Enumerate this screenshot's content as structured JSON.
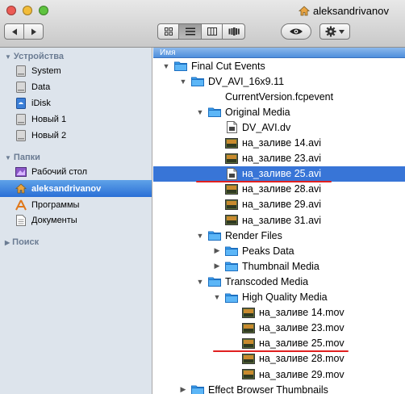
{
  "window": {
    "title": "aleksandrivanov",
    "title_icon": "home-icon"
  },
  "toolbar": {
    "back_icon": "back-arrow-icon",
    "forward_icon": "forward-arrow-icon",
    "views": [
      {
        "name": "icon-view",
        "icon": "grid-icon",
        "active": false
      },
      {
        "name": "list-view",
        "icon": "list-icon",
        "active": true
      },
      {
        "name": "column-view",
        "icon": "columns-icon",
        "active": false
      },
      {
        "name": "coverflow-view",
        "icon": "coverflow-icon",
        "active": false
      }
    ],
    "quicklook_icon": "eye-icon",
    "action_icon": "gear-icon"
  },
  "sidebar": {
    "devices": {
      "header": "Устройства",
      "items": [
        {
          "label": "System",
          "icon": "hard-drive-icon"
        },
        {
          "label": "Data",
          "icon": "hard-drive-icon"
        },
        {
          "label": "iDisk",
          "icon": "idisk-icon"
        },
        {
          "label": "Новый 1",
          "icon": "hard-drive-icon"
        },
        {
          "label": "Новый 2",
          "icon": "hard-drive-icon"
        }
      ]
    },
    "places": {
      "header": "Папки",
      "items": [
        {
          "label": "Рабочий стол",
          "icon": "desktop-icon"
        },
        {
          "label": "aleksandrivanov",
          "icon": "home-icon",
          "selected": true
        },
        {
          "label": "Программы",
          "icon": "applications-icon"
        },
        {
          "label": "Документы",
          "icon": "documents-icon"
        }
      ]
    },
    "search": {
      "header": "Поиск"
    }
  },
  "list": {
    "column_header": "Имя",
    "rows": [
      {
        "label": "Final Cut Events",
        "depth": 0,
        "disclosure": "open",
        "icon": "folder-icon"
      },
      {
        "label": "DV_AVI_16x9.11",
        "depth": 1,
        "disclosure": "open",
        "icon": "folder-icon"
      },
      {
        "label": "CurrentVersion.fcpevent",
        "depth": 2,
        "disclosure": "none",
        "icon": "none"
      },
      {
        "label": "Original Media",
        "depth": 2,
        "disclosure": "open",
        "icon": "folder-icon"
      },
      {
        "label": "DV_AVI.dv",
        "depth": 3,
        "disclosure": "none",
        "icon": "document-icon"
      },
      {
        "label": "на_заливе 14.avi",
        "depth": 3,
        "disclosure": "none",
        "icon": "video-thumb-icon"
      },
      {
        "label": "на_заливе 23.avi",
        "depth": 3,
        "disclosure": "none",
        "icon": "video-thumb-icon"
      },
      {
        "label": "на_заливе 25.avi",
        "depth": 3,
        "disclosure": "none",
        "icon": "document-icon",
        "selected": true,
        "underlined": true
      },
      {
        "label": "на_заливе 28.avi",
        "depth": 3,
        "disclosure": "none",
        "icon": "video-thumb-icon"
      },
      {
        "label": "на_заливе 29.avi",
        "depth": 3,
        "disclosure": "none",
        "icon": "video-thumb-icon"
      },
      {
        "label": "на_заливе 31.avi",
        "depth": 3,
        "disclosure": "none",
        "icon": "video-thumb-icon"
      },
      {
        "label": "Render Files",
        "depth": 2,
        "disclosure": "open",
        "icon": "folder-icon"
      },
      {
        "label": "Peaks Data",
        "depth": 3,
        "disclosure": "closed",
        "icon": "folder-icon"
      },
      {
        "label": "Thumbnail Media",
        "depth": 3,
        "disclosure": "closed",
        "icon": "folder-icon"
      },
      {
        "label": "Transcoded Media",
        "depth": 2,
        "disclosure": "open",
        "icon": "folder-icon"
      },
      {
        "label": "High Quality Media",
        "depth": 3,
        "disclosure": "open",
        "icon": "folder-icon"
      },
      {
        "label": "на_заливе 14.mov",
        "depth": 4,
        "disclosure": "none",
        "icon": "video-thumb-icon"
      },
      {
        "label": "на_заливе 23.mov",
        "depth": 4,
        "disclosure": "none",
        "icon": "video-thumb-icon"
      },
      {
        "label": "на_заливе 25.mov",
        "depth": 4,
        "disclosure": "none",
        "icon": "video-thumb-icon",
        "underlined": true
      },
      {
        "label": "на_заливе 28.mov",
        "depth": 4,
        "disclosure": "none",
        "icon": "video-thumb-icon"
      },
      {
        "label": "на_заливе 29.mov",
        "depth": 4,
        "disclosure": "none",
        "icon": "video-thumb-icon"
      },
      {
        "label": "Effect Browser Thumbnails",
        "depth": 1,
        "disclosure": "closed",
        "icon": "folder-icon"
      }
    ]
  },
  "colors": {
    "selection": "#3875d7",
    "sidebar_selection": "#2a6fd6",
    "folder": "#3aa0f0",
    "annotation_underline": "#e02020"
  }
}
